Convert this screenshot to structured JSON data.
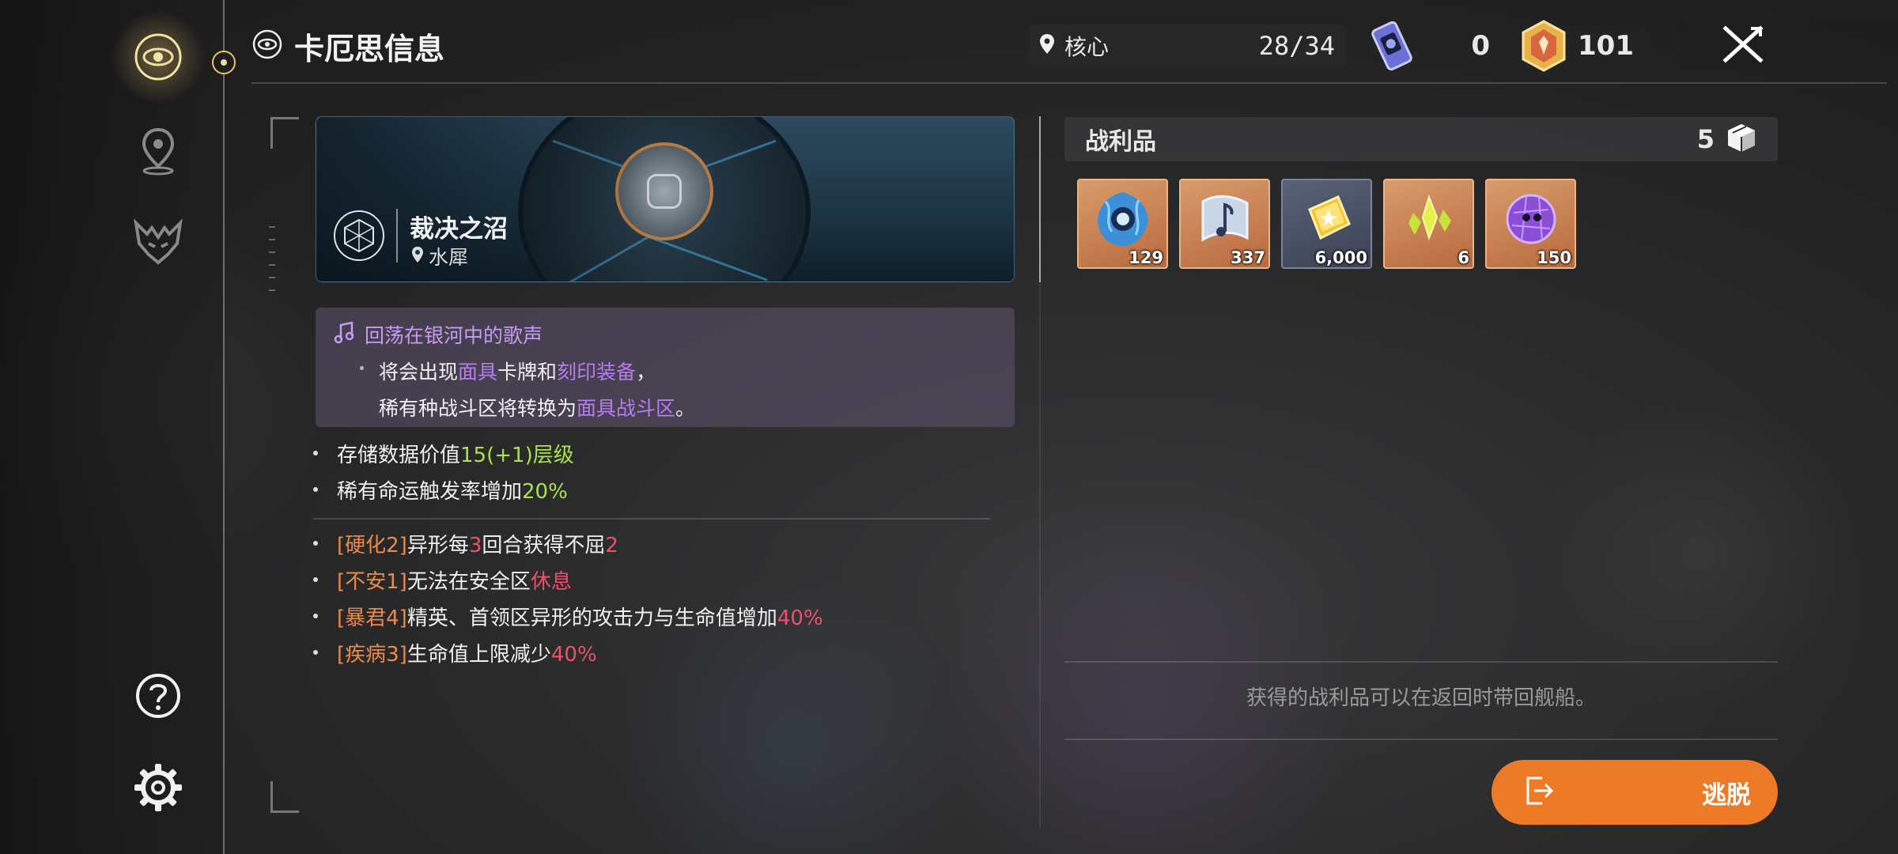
{
  "header": {
    "title": "卡厄思信息"
  },
  "location": {
    "label": "核心",
    "progress": "28/34"
  },
  "currencies": [
    {
      "name": "ticket-icon",
      "value": "0"
    },
    {
      "name": "crystal-icon",
      "value": "101"
    }
  ],
  "stage": {
    "name": "裁决之沼",
    "area": "水犀"
  },
  "event": {
    "title": "回荡在银河中的歌声",
    "line1_prefix": "将会出现",
    "line1_hl1": "面具",
    "line1_mid": "卡牌和",
    "line1_hl2": "刻印装备",
    "line1_suffix": "，",
    "line2_prefix": "稀有种战斗区将转换为",
    "line2_hl": "面具战斗区",
    "line2_suffix": "。"
  },
  "stats": [
    {
      "text": "存储数据价值",
      "value": "15(+1)层级"
    },
    {
      "text": "稀有命运触发率增加",
      "value": "20%"
    }
  ],
  "modifiers": [
    {
      "tag": "[硬化2]",
      "p1": "异形每",
      "n1": "3",
      "p2": "回合获得不屈",
      "n2": "2"
    },
    {
      "tag": "[不安1]",
      "p1": "无法在安全区",
      "n1": "休息",
      "p2": "",
      "n2": ""
    },
    {
      "tag": "[暴君4]",
      "p1": "精英、首领区异形的攻击力与生命值增加",
      "n1": "40%",
      "p2": "",
      "n2": ""
    },
    {
      "tag": "[疾病3]",
      "p1": "生命值上限减少",
      "n1": "40%",
      "p2": "",
      "n2": ""
    }
  ],
  "loot": {
    "title": "战利品",
    "count": "5",
    "items": [
      {
        "icon": "blue-eye-orb-icon",
        "count": "129"
      },
      {
        "icon": "music-note-scroll-icon",
        "count": "337"
      },
      {
        "icon": "gold-credit-icon",
        "count": "6,000"
      },
      {
        "icon": "yellow-crystal-shards-icon",
        "count": "6"
      },
      {
        "icon": "purple-skull-orb-icon",
        "count": "150"
      }
    ],
    "note": "获得的战利品可以在返回时带回舰船。"
  },
  "actions": {
    "escape": "逃脱"
  },
  "colors": {
    "accent_orange": "#ec7a26",
    "highlight_green": "#a9e34b",
    "highlight_red": "#ee4f6b",
    "tag_orange": "#e98a4c",
    "event_purple": "#b77df0"
  }
}
